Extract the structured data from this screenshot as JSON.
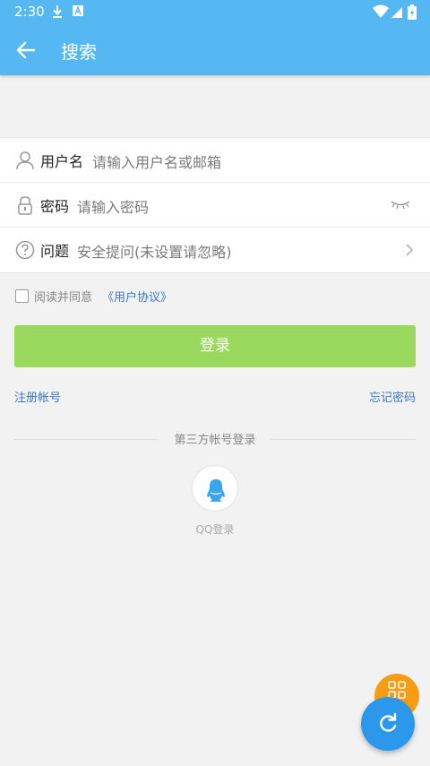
{
  "status_bar": {
    "time": "2:30"
  },
  "app_bar": {
    "title": "搜索"
  },
  "form": {
    "username": {
      "label": "用户名",
      "placeholder": "请输入用户名或邮箱"
    },
    "password": {
      "label": "密码",
      "placeholder": "请输入密码"
    },
    "question": {
      "label": "问题",
      "placeholder": "安全提问(未设置请忽略)"
    }
  },
  "agreement": {
    "text": "阅读并同意",
    "link": "《用户协议》"
  },
  "login_button": "登录",
  "links": {
    "register": "注册帐号",
    "forgot": "忘记密码"
  },
  "third_party": {
    "title": "第三方帐号登录",
    "qq_label": "QQ登录"
  },
  "colors": {
    "accent": "#56b8f2",
    "login_green": "#98d95e",
    "link_blue": "#3a78c9",
    "fab_orange": "#f89c14",
    "fab_blue": "#2b98ec"
  },
  "icons": [
    "back-arrow-icon",
    "user-icon",
    "lock-icon",
    "question-icon",
    "eye-closed-icon",
    "chevron-right-icon",
    "qq-penguin-icon",
    "apps-icon",
    "refresh-icon"
  ]
}
